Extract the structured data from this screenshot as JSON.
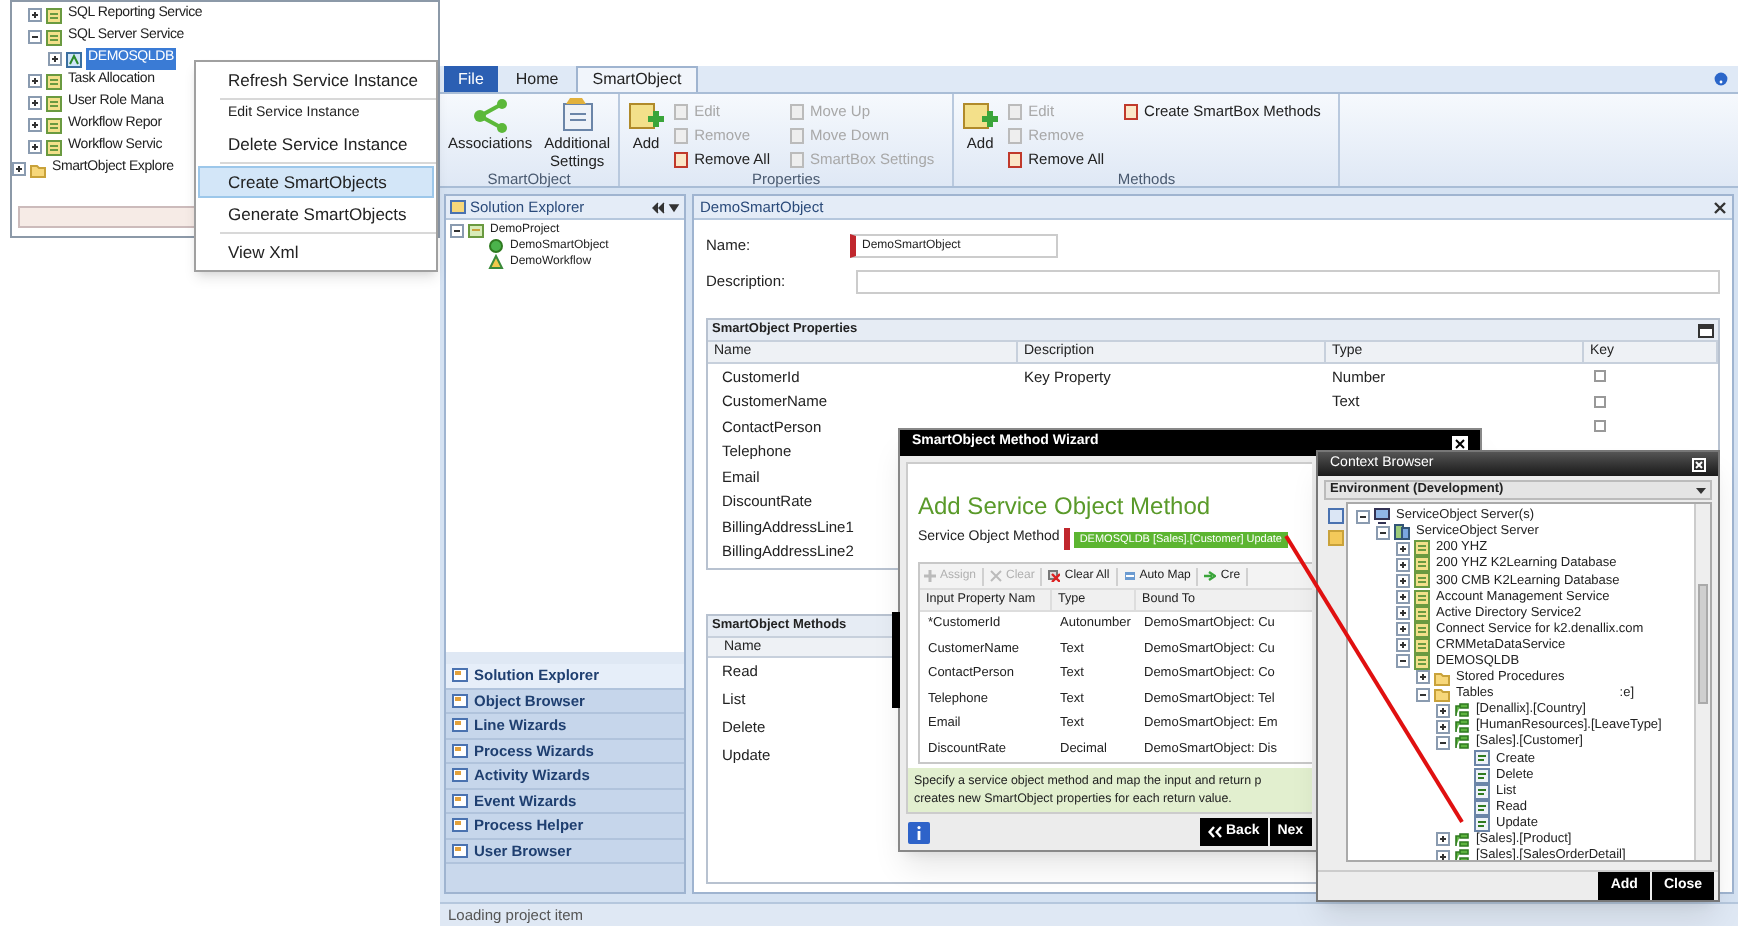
{
  "service_tree": {
    "items": [
      {
        "label": "SQL Reporting Service",
        "kind": "service",
        "expanded": false,
        "selected": false
      },
      {
        "label": "SQL Server Service",
        "kind": "service",
        "expanded": true,
        "selected": false,
        "children": [
          {
            "label": "DEMOSQLDB",
            "kind": "instance",
            "expanded": false,
            "selected": true
          }
        ]
      },
      {
        "label": "Task Allocation",
        "kind": "service",
        "expanded": false,
        "selected": false
      },
      {
        "label": "User Role Mana",
        "kind": "service",
        "expanded": false,
        "selected": false
      },
      {
        "label": "Workflow Repor",
        "kind": "service",
        "expanded": false,
        "selected": false
      },
      {
        "label": "Workflow Servic",
        "kind": "service",
        "expanded": false,
        "selected": false
      }
    ],
    "root_items": [
      {
        "label": "SmartObject Explore",
        "kind": "folder",
        "expanded": false,
        "selected": false
      }
    ]
  },
  "context_menu": [
    {
      "label": "Refresh Service Instance",
      "kind": "large",
      "selected": false,
      "separator_after": true
    },
    {
      "label": "Edit Service Instance",
      "kind": "small",
      "selected": false,
      "separator_after": false
    },
    {
      "label": "Delete Service Instance",
      "kind": "large",
      "selected": false,
      "separator_after": true
    },
    {
      "label": "Create SmartObjects",
      "kind": "large",
      "selected": true,
      "separator_after": false
    },
    {
      "label": "Generate SmartObjects",
      "kind": "large",
      "selected": false,
      "separator_after": true
    },
    {
      "label": "View Xml",
      "kind": "large",
      "selected": false,
      "separator_after": false
    }
  ],
  "ribbon": {
    "tabs": [
      {
        "label": "File",
        "kind": "file",
        "selected": false
      },
      {
        "label": "Home",
        "kind": "tab",
        "selected": false
      },
      {
        "label": "SmartObject",
        "kind": "tab",
        "selected": true
      }
    ],
    "groups": [
      {
        "title": "SmartObject",
        "large": [
          {
            "label": "Associations",
            "kind": "associations"
          },
          {
            "label": "Additional Settings",
            "kind": "settings"
          }
        ]
      },
      {
        "title": "Properties",
        "large": [
          {
            "label": "Add",
            "kind": "add"
          }
        ],
        "columns": [
          [
            {
              "label": "Edit",
              "disabled": true
            },
            {
              "label": "Remove",
              "disabled": true
            },
            {
              "label": "Remove All",
              "disabled": false
            }
          ],
          [
            {
              "label": "Move Up",
              "disabled": true
            },
            {
              "label": "Move Down",
              "disabled": true
            },
            {
              "label": "SmartBox Settings",
              "disabled": true
            }
          ]
        ]
      },
      {
        "title": "Methods",
        "large": [
          {
            "label": "Add",
            "kind": "add"
          }
        ],
        "columns": [
          [
            {
              "label": "Edit",
              "disabled": true
            },
            {
              "label": "Remove",
              "disabled": true
            },
            {
              "label": "Remove All",
              "disabled": false
            }
          ],
          [
            {
              "label": "Create SmartBox Methods",
              "disabled": false
            }
          ]
        ]
      }
    ]
  },
  "solution_explorer": {
    "title": "Solution Explorer",
    "tree": [
      {
        "label": "DemoProject",
        "kind": "project",
        "expanded": true,
        "selected": false,
        "children": [
          {
            "label": "DemoSmartObject",
            "kind": "smartobject",
            "selected": false
          },
          {
            "label": "DemoWorkflow",
            "kind": "workflow",
            "selected": false
          }
        ]
      }
    ],
    "nav": [
      {
        "label": "Solution Explorer",
        "selected": true
      },
      {
        "label": "Object Browser",
        "selected": false
      },
      {
        "label": "Line Wizards",
        "selected": false
      },
      {
        "label": "Process Wizards",
        "selected": false
      },
      {
        "label": "Activity Wizards",
        "selected": false
      },
      {
        "label": "Event Wizards",
        "selected": false
      },
      {
        "label": "Process Helper",
        "selected": false
      },
      {
        "label": "User Browser",
        "selected": false
      }
    ]
  },
  "designer": {
    "title": "DemoSmartObject",
    "name_label": "Name:",
    "name_value": "DemoSmartObject",
    "description_label": "Description:",
    "properties": {
      "title": "SmartObject Properties",
      "columns": [
        "Name",
        "Description",
        "Type",
        "Key"
      ],
      "rows": [
        {
          "name": "CustomerId",
          "description": "Key Property",
          "type": "Number",
          "key": false
        },
        {
          "name": "CustomerName",
          "type": "Text",
          "key": false
        },
        {
          "name": "ContactPerson",
          "key": false
        },
        {
          "name": "Telephone"
        },
        {
          "name": "Email"
        },
        {
          "name": "DiscountRate"
        },
        {
          "name": "BillingAddressLine1"
        },
        {
          "name": "BillingAddressLine2"
        }
      ]
    },
    "methods": {
      "title": "SmartObject Methods",
      "column": "Name",
      "rows": [
        "Read",
        "List",
        "Delete",
        "Update"
      ]
    }
  },
  "status_bar": "Loading project item",
  "wizard": {
    "title": "SmartObject Method Wizard",
    "heading": "Add Service Object Method",
    "method_label": "Service Object Method",
    "method_value": "DEMOSQLDB [Sales].[Customer] Update",
    "toolbar": [
      {
        "label": "Assign",
        "kind": "assign",
        "disabled": true
      },
      {
        "label": "Clear",
        "kind": "clear",
        "disabled": true
      },
      {
        "label": "Clear All",
        "kind": "clear_all",
        "disabled": false
      },
      {
        "label": "Auto Map",
        "kind": "auto_map",
        "disabled": false
      },
      {
        "label": "Cre",
        "kind": "create",
        "disabled": false
      }
    ],
    "columns": [
      "Input Property Nam",
      "Type",
      "Bound To"
    ],
    "rows": [
      [
        "*CustomerId",
        "Autonumber",
        "DemoSmartObject: Cu"
      ],
      [
        "CustomerName",
        "Text",
        "DemoSmartObject: Cu"
      ],
      [
        "ContactPerson",
        "Text",
        "DemoSmartObject: Co"
      ],
      [
        "Telephone",
        "Text",
        "DemoSmartObject: Tel"
      ],
      [
        "Email",
        "Text",
        "DemoSmartObject: Em"
      ],
      [
        "DiscountRate",
        "Decimal",
        "DemoSmartObject: Dis"
      ]
    ],
    "help_lines": [
      "Specify a service object method and map the input and return p",
      "creates new SmartObject properties for each return value."
    ],
    "buttons": [
      "Back",
      "Nex"
    ]
  },
  "context_browser": {
    "title": "Context Browser",
    "environment": "Environment (Development)",
    "tree": [
      {
        "label": "ServiceObject Server(s)",
        "kind": "servers",
        "expanded": true,
        "selected": false,
        "children": [
          {
            "label": "ServiceObject Server",
            "kind": "server",
            "expanded": true,
            "selected": false,
            "children": [
              {
                "label": "200 YHZ",
                "kind": "service",
                "expanded": false,
                "selected": false
              },
              {
                "label": "200 YHZ K2Learning Database",
                "kind": "service",
                "expanded": false,
                "selected": false
              },
              {
                "label": "300 CMB K2Learning Database",
                "kind": "service",
                "expanded": false,
                "selected": false
              },
              {
                "label": "Account Management Service",
                "kind": "service",
                "expanded": false,
                "selected": false
              },
              {
                "label": "Active Directory Service2",
                "kind": "service",
                "expanded": false,
                "selected": false
              },
              {
                "label": "Connect Service for k2.denallix.com",
                "kind": "service",
                "expanded": false,
                "selected": false
              },
              {
                "label": "CRMMetaDataService",
                "kind": "service",
                "expanded": false,
                "selected": false
              },
              {
                "label": "DEMOSQLDB",
                "kind": "service",
                "expanded": true,
                "selected": false,
                "children": [
                  {
                    "label": "Stored Procedures",
                    "kind": "folder",
                    "expanded": false,
                    "selected": false
                  },
                  {
                    "label": "Tables",
                    "kind": "folder",
                    "expanded": true,
                    "selected": false,
                    "note": ":e]",
                    "children": [
                      {
                        "label": "[Denallix].[Country]",
                        "kind": "object",
                        "expanded": false,
                        "selected": false
                      },
                      {
                        "label": "[HumanResources].[LeaveType]",
                        "kind": "object",
                        "expanded": false,
                        "selected": false
                      },
                      {
                        "label": "[Sales].[Customer]",
                        "kind": "object",
                        "expanded": true,
                        "selected": false,
                        "children": [
                          {
                            "label": "Create",
                            "kind": "method",
                            "selected": false
                          },
                          {
                            "label": "Delete",
                            "kind": "method",
                            "selected": false
                          },
                          {
                            "label": "List",
                            "kind": "method",
                            "selected": false
                          },
                          {
                            "label": "Read",
                            "kind": "method",
                            "selected": false
                          },
                          {
                            "label": "Update",
                            "kind": "method",
                            "selected": false
                          }
                        ]
                      },
                      {
                        "label": "[Sales].[Product]",
                        "kind": "object",
                        "expanded": false,
                        "selected": false
                      },
                      {
                        "label": "[Sales].[SalesOrderDetail]",
                        "kind": "object",
                        "expanded": false,
                        "selected": false
                      }
                    ]
                  }
                ]
              }
            ]
          }
        ]
      }
    ],
    "buttons": [
      "Add",
      "Close"
    ]
  }
}
